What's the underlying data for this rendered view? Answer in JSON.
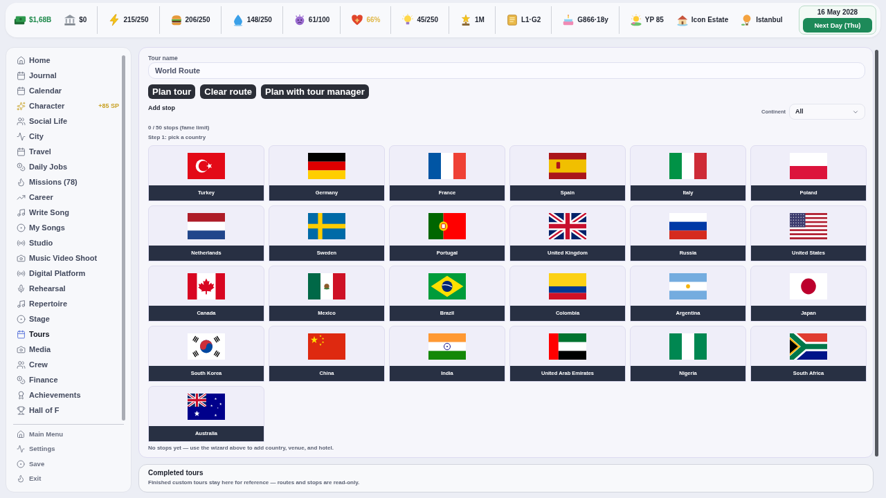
{
  "status_bar": {
    "groups": [
      {
        "stats": [
          {
            "value": "$1,68B",
            "color": "#1f8a4c"
          },
          {
            "value": "$0",
            "color": "#1f2430"
          }
        ]
      },
      {
        "stats": [
          {
            "value": "215/250",
            "color": "#1f2430"
          }
        ]
      },
      {
        "stats": [
          {
            "value": "206/250",
            "color": "#1f2430"
          }
        ]
      },
      {
        "stats": [
          {
            "value": "148/250",
            "color": "#1f2430"
          }
        ]
      },
      {
        "stats": [
          {
            "value": "61/100",
            "color": "#1f2430"
          }
        ]
      },
      {
        "stats": [
          {
            "value": "66%",
            "color": "#e0b84a"
          }
        ]
      },
      {
        "stats": [
          {
            "value": "45/250",
            "color": "#1f2430"
          }
        ]
      },
      {
        "stats": [
          {
            "value": "1M",
            "color": "#1f2430"
          }
        ]
      },
      {
        "stats": [
          {
            "value": "L1·G2",
            "color": "#1f2430"
          }
        ]
      },
      {
        "stats": [
          {
            "value": "G866·18y",
            "color": "#1f2430"
          }
        ]
      },
      {
        "stats": [
          {
            "value": "YP 85",
            "color": "#1f2430"
          },
          {
            "value": "Icon Estate",
            "color": "#1f2430"
          },
          {
            "value": "Istanbul",
            "color": "#1f2430"
          }
        ]
      }
    ],
    "date": "16 May 2028",
    "next_day_button": "Next Day (Thu)"
  },
  "sidebar": {
    "items": [
      {
        "label": "Home",
        "selected": false
      },
      {
        "label": "Journal",
        "selected": false
      },
      {
        "label": "Calendar",
        "selected": false
      },
      {
        "label": "Character",
        "selected": false,
        "badge": "+85 SP"
      },
      {
        "label": "Social Life",
        "selected": false
      },
      {
        "label": "City",
        "selected": false
      },
      {
        "label": "Travel",
        "selected": false
      },
      {
        "label": "Daily Jobs",
        "selected": false
      },
      {
        "label": "Missions (78)",
        "selected": false
      },
      {
        "label": "Career",
        "selected": false
      },
      {
        "label": "Write Song",
        "selected": false
      },
      {
        "label": "My Songs",
        "selected": false
      },
      {
        "label": "Studio",
        "selected": false
      },
      {
        "label": "Music Video Shoot",
        "selected": false
      },
      {
        "label": "Digital Platform",
        "selected": false
      },
      {
        "label": "Rehearsal",
        "selected": false
      },
      {
        "label": "Repertoire",
        "selected": false
      },
      {
        "label": "Stage",
        "selected": false
      },
      {
        "label": "Tours",
        "selected": true
      },
      {
        "label": "Media",
        "selected": false
      },
      {
        "label": "Crew",
        "selected": false
      },
      {
        "label": "Finance",
        "selected": false
      },
      {
        "label": "Achievements",
        "selected": false
      },
      {
        "label": "Hall of F",
        "selected": false
      }
    ],
    "footer_items": [
      "Main Menu",
      "Settings",
      "Save",
      "Exit"
    ]
  },
  "tour_planner": {
    "name_label": "Tour name",
    "name_value": "World Route",
    "buttons": [
      "Plan tour",
      "Clear route",
      "Plan with tour manager"
    ],
    "add_stop_heading": "Add stop",
    "continent": {
      "label": "Continent",
      "value": "All"
    },
    "stops_count": "0 / 50 stops (fame limit)",
    "step": "Step 1: pick a country",
    "countries": [
      "Turkey",
      "Germany",
      "France",
      "Spain",
      "Italy",
      "Poland",
      "Netherlands",
      "Sweden",
      "Portugal",
      "United Kingdom",
      "Russia",
      "United States",
      "Canada",
      "Mexico",
      "Brazil",
      "Colombia",
      "Argentina",
      "Japan",
      "South Korea",
      "China",
      "India",
      "United Arab Emirates",
      "Nigeria",
      "South Africa",
      "Australia"
    ],
    "empty_note": "No stops yet — use the wizard above to add country, venue, and hotel."
  },
  "completed_tours": {
    "title": "Completed tours",
    "note": "Finished custom tours stay here for reference — routes and stops are read-only."
  }
}
